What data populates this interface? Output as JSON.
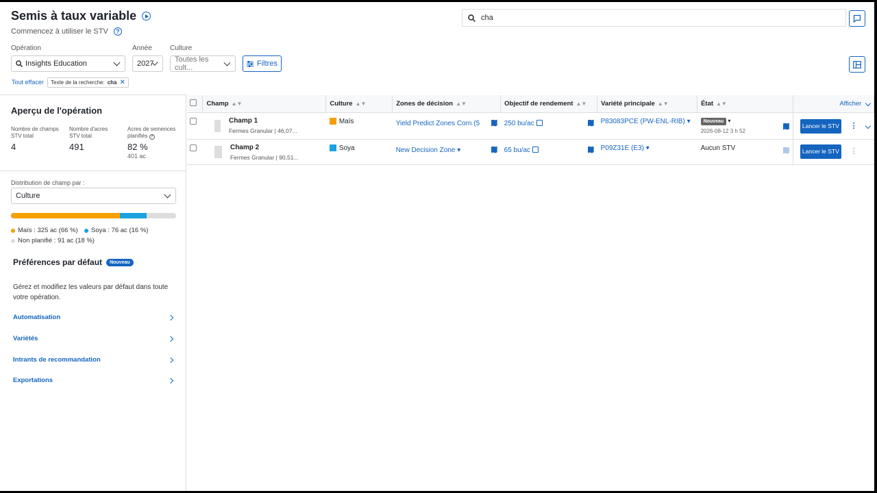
{
  "header": {
    "title": "Semis à taux variable",
    "subtitle": "Commencez à utiliser le STV"
  },
  "search": {
    "value": "cha"
  },
  "filters": {
    "operation_label": "Opération",
    "operation_value": "Insights Education",
    "year_label": "Année",
    "year_value": "2027",
    "crop_label": "Culture",
    "crop_value": "Toutes les cult...",
    "filters_button": "Filtres",
    "clear_all": "Tout effacer",
    "chip_label": "Texte de la recherche:",
    "chip_value": "cha"
  },
  "overview": {
    "title": "Aperçu de l'opération",
    "stats": [
      {
        "label": "Nombre de champs STV total",
        "value": "4"
      },
      {
        "label": "Nombre d'acres STV total",
        "value": "491"
      },
      {
        "label": "Acres de semences planifiés",
        "value": "82 %",
        "sub": "401 ac"
      }
    ],
    "distribution_label": "Distribution de champ par :",
    "distribution_value": "Culture",
    "distribution": [
      {
        "name": "Maïs : 325 ac (66 %)",
        "color": "#f5a000",
        "fraction": 0.66
      },
      {
        "name": "Soya : 76 ac (16 %)",
        "color": "#1aa3de",
        "fraction": 0.16
      },
      {
        "name": "Non planifié : 91 ac (18 %)",
        "color": "#dddddd",
        "fraction": 0.18
      }
    ]
  },
  "prefs": {
    "title": "Préférences par défaut",
    "badge": "Nouveau",
    "description": "Gérez et modifiez les valeurs par défaut dans toute votre opération.",
    "links": [
      "Automatisation",
      "Variétés",
      "Intrants de recommandation",
      "Exportations"
    ]
  },
  "table": {
    "columns": [
      "Champ",
      "Culture",
      "Zones de décision",
      "Objectif de rendement",
      "Variété principale",
      "État"
    ],
    "show_label": "Afficher",
    "rows": [
      {
        "field": "Champ 1",
        "farm": "Fermes Granular",
        "area": "46,07...",
        "crop": "Maïs",
        "crop_color": "#f5a000",
        "zone": "Yield Predict Zones Corn (5",
        "goal": "250 bu/ac",
        "variety": "P83083PCE (PW-ENL-RIB)",
        "status_badge": "Nouveau",
        "status_date": "2026-08-12 3 h 52",
        "action": "Lancer le STV"
      },
      {
        "field": "Champ 2",
        "farm": "Fermes Granular",
        "area": "90,51...",
        "crop": "Soya",
        "crop_color": "#1aa3de",
        "zone": "New Decision Zone",
        "goal": "65 bu/ac",
        "variety": "P09Z31E (E3)",
        "status_text": "Aucun STV",
        "action": "Lancer le STV"
      }
    ]
  },
  "icons": [
    "play-circle-icon",
    "help-icon",
    "search-icon",
    "chat-icon",
    "layout-icon",
    "filter-icon",
    "sort-icon",
    "map-icon",
    "external-link-icon",
    "chevron-down-icon",
    "chevron-right-icon",
    "kebab-icon"
  ]
}
